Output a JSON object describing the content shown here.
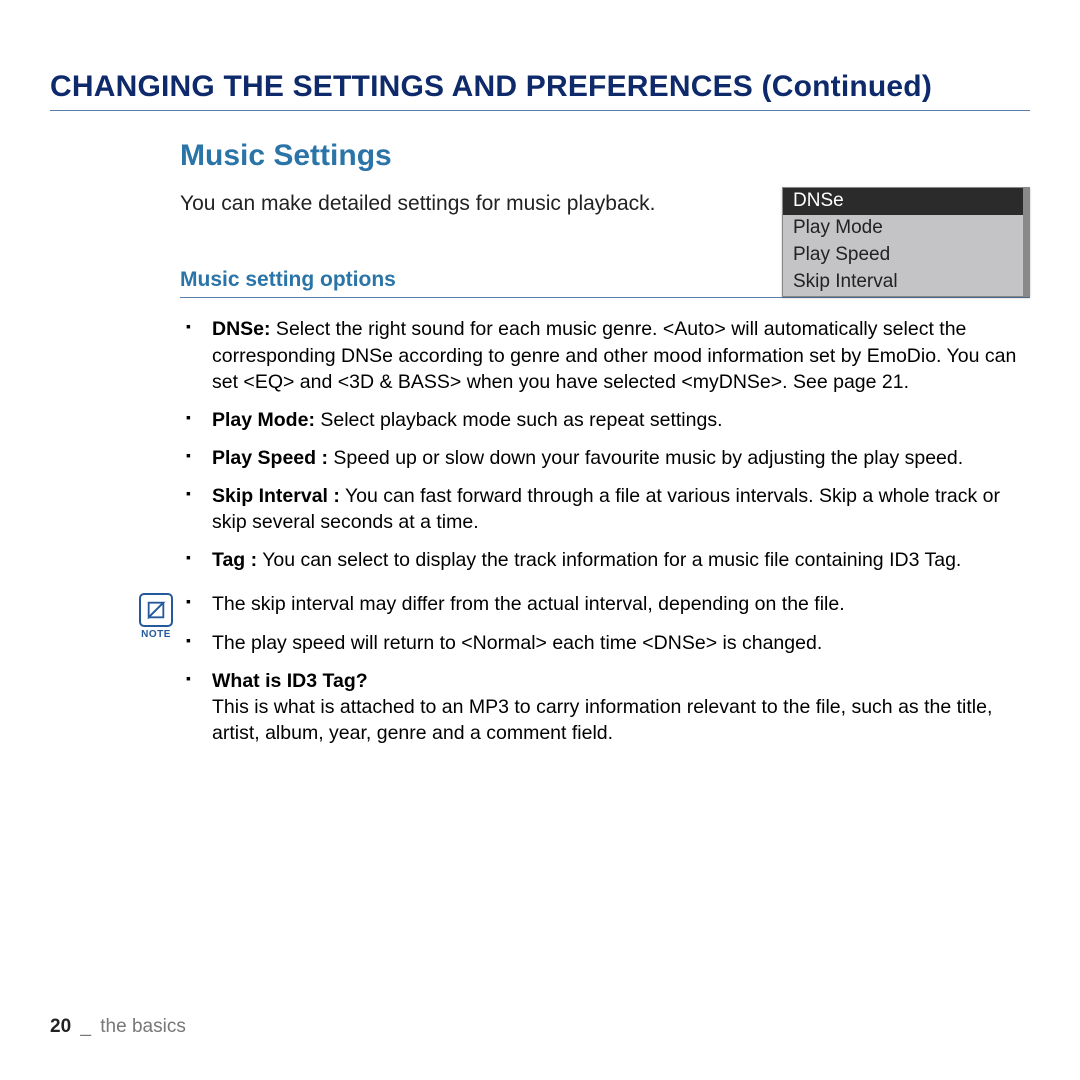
{
  "page_title": "CHANGING THE SETTINGS AND PREFERENCES (Continued)",
  "section_heading": "Music Settings",
  "intro": "You can make detailed settings for music playback.",
  "menu": {
    "items": [
      "DNSe",
      "Play Mode",
      "Play Speed",
      "Skip Interval"
    ],
    "selected_index": 0
  },
  "sub_heading": "Music setting options",
  "options": [
    {
      "label": "DNSe:",
      "text": " Select the right sound for each music genre. <Auto> will automatically select the corresponding DNSe according to genre and other mood information set by EmoDio. You can set <EQ> and <3D & BASS> when you have selected <myDNSe>. See page 21."
    },
    {
      "label": "Play Mode:",
      "text": " Select playback mode such as repeat settings."
    },
    {
      "label": "Play Speed :",
      "text": " Speed up or slow down your favourite music by adjusting the play speed."
    },
    {
      "label": "Skip Interval :",
      "text": " You can fast forward through a file at various intervals. Skip a whole track or skip several seconds at a time."
    },
    {
      "label": "Tag :",
      "text": " You can select to display the track information for a music file containing ID3 Tag."
    }
  ],
  "note_label": "NOTE",
  "notes": [
    {
      "text": "The skip interval may differ from the actual interval, depending on the file."
    },
    {
      "text": "The play speed will return to <Normal> each time <DNSe> is changed."
    },
    {
      "bold": "What is ID3 Tag?",
      "text": "This is what is attached to an MP3 to carry information relevant to the file, such as the title, artist, album, year, genre and a comment field."
    }
  ],
  "footer": {
    "page": "20",
    "sep": "_",
    "section": "the basics"
  }
}
